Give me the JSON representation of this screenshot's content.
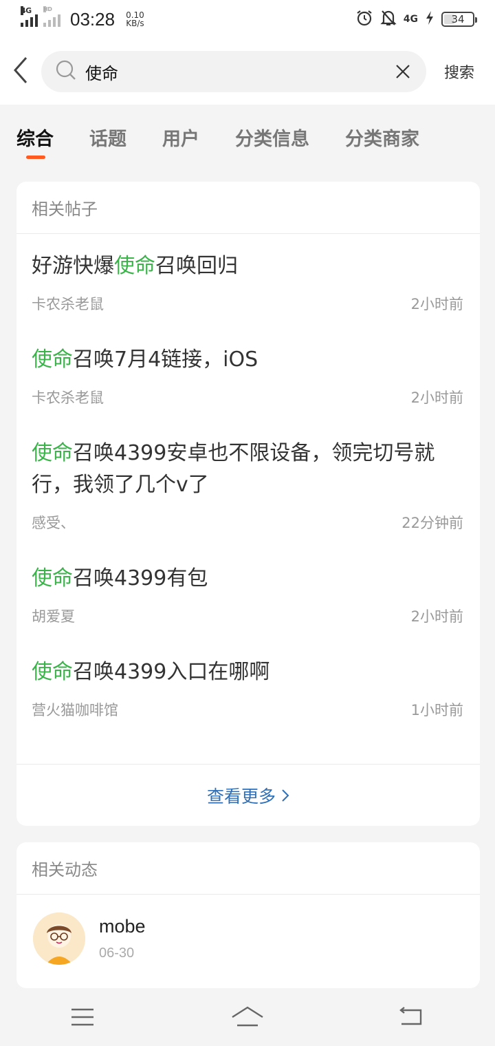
{
  "status": {
    "net1": "4G",
    "net2": "HD",
    "time": "03:28",
    "speed_value": "0.10",
    "speed_unit": "KB/s",
    "net_right": "4G",
    "battery_percent": "34"
  },
  "search": {
    "query": "使命",
    "submit_label": "搜索"
  },
  "tabs": [
    {
      "label": "综合",
      "active": true
    },
    {
      "label": "话题",
      "active": false
    },
    {
      "label": "用户",
      "active": false
    },
    {
      "label": "分类信息",
      "active": false
    },
    {
      "label": "分类商家",
      "active": false
    }
  ],
  "posts_section": {
    "title": "相关帖子",
    "highlight_color": "#3bb34a",
    "items": [
      {
        "pre": "好游快爆",
        "hl": "使命",
        "post": "召唤回归",
        "author": "卡农杀老鼠",
        "time": "2小时前"
      },
      {
        "pre": "",
        "hl": "使命",
        "post": "召唤7月4链接，iOS",
        "author": "卡农杀老鼠",
        "time": "2小时前"
      },
      {
        "pre": "",
        "hl": "使命",
        "post": "召唤4399安卓也不限设备，领完切号就行，我领了几个v了",
        "author": "感受、",
        "time": "22分钟前"
      },
      {
        "pre": "",
        "hl": "使命",
        "post": "召唤4399有包",
        "author": "胡爱夏",
        "time": "2小时前"
      },
      {
        "pre": "",
        "hl": "使命",
        "post": "召唤4399入口在哪啊",
        "author": "营火猫咖啡馆",
        "time": "1小时前"
      }
    ],
    "more_label": "查看更多"
  },
  "feed_section": {
    "title": "相关动态",
    "user_name": "mobe",
    "date": "06-30"
  },
  "icons": {
    "back": "chevron-left-icon",
    "search": "search-icon",
    "clear": "close-icon",
    "alarm": "alarm-icon",
    "mute": "bell-off-icon",
    "charging": "bolt-icon",
    "nav_menu": "menu-icon",
    "nav_home": "home-icon",
    "nav_back": "return-icon"
  },
  "colors": {
    "accent": "#ff5a1f",
    "link": "#2f6fb7"
  }
}
